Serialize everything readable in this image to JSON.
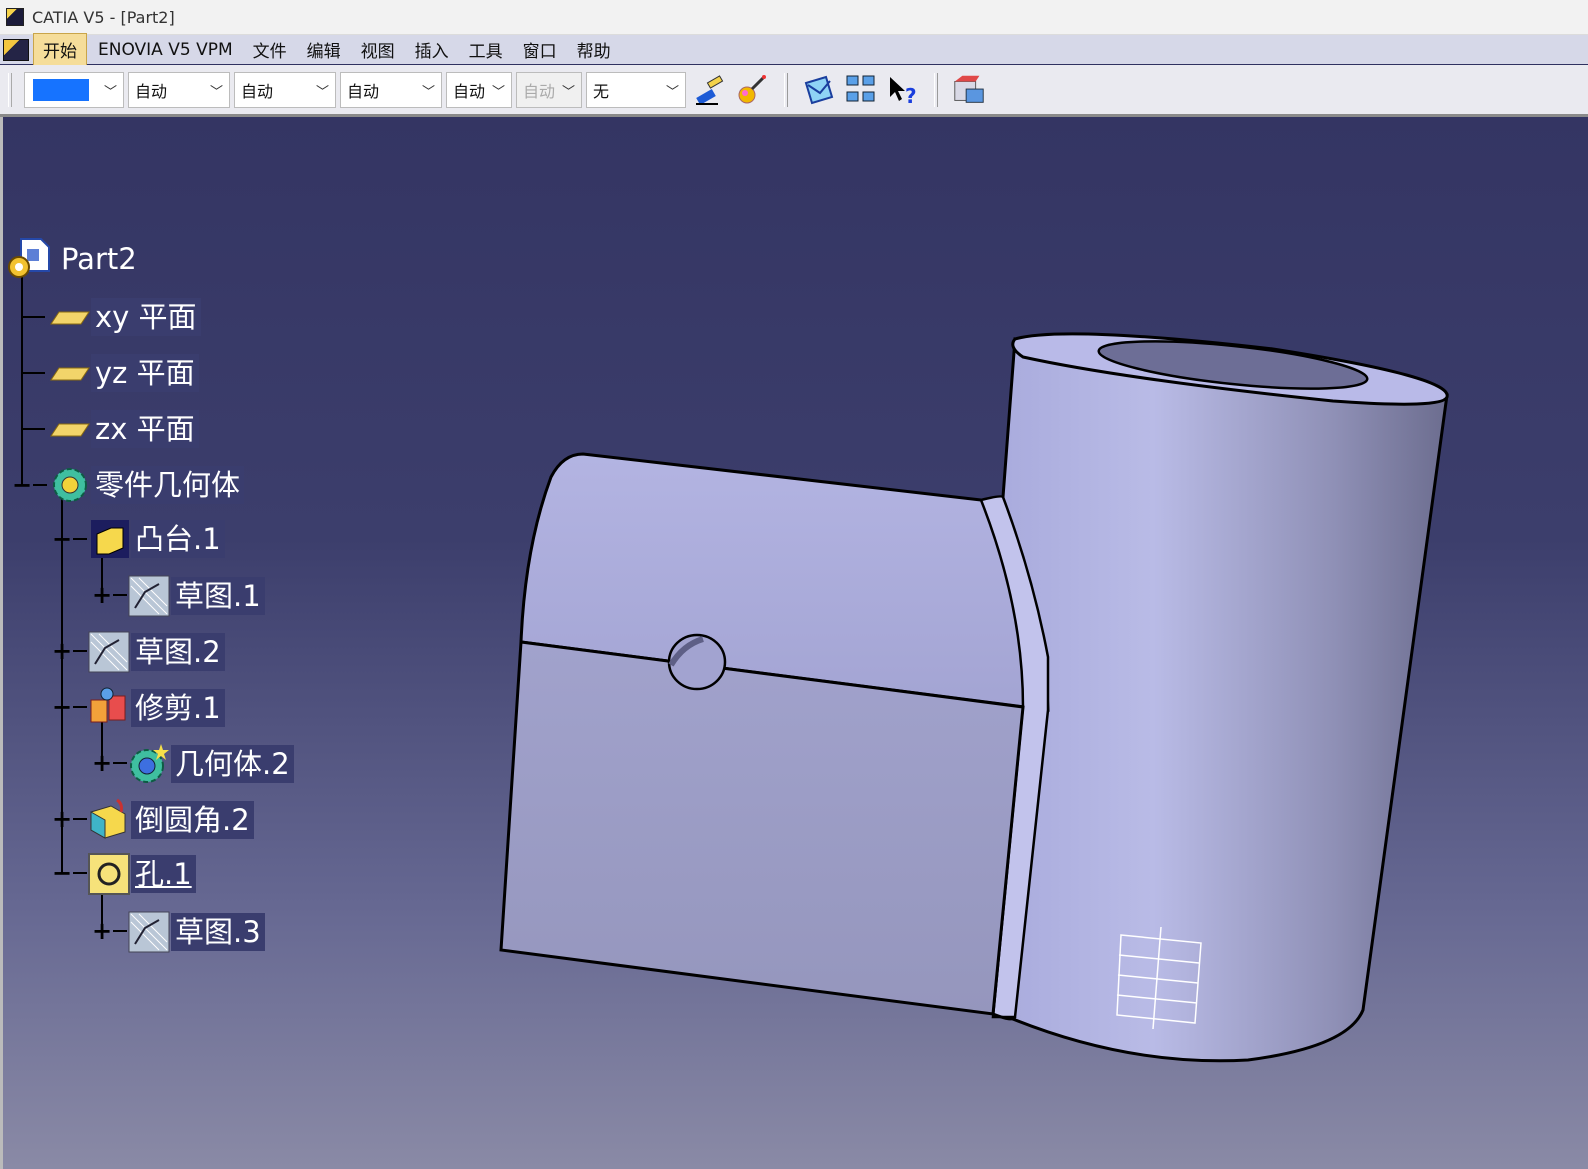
{
  "window": {
    "title": "CATIA V5 - [Part2]"
  },
  "menu": {
    "items": [
      {
        "label": "开始",
        "active": true
      },
      {
        "label": "ENOVIA V5 VPM"
      },
      {
        "label": "文件"
      },
      {
        "label": "编辑"
      },
      {
        "label": "视图"
      },
      {
        "label": "插入"
      },
      {
        "label": "工具"
      },
      {
        "label": "窗口"
      },
      {
        "label": "帮助"
      }
    ]
  },
  "toolbar": {
    "color_value": "#1673ff",
    "combos": [
      "自动",
      "自动",
      "自动",
      "自动",
      "自动",
      "无"
    ],
    "icons": [
      "paint-brush-icon",
      "magic-wand-icon",
      "graphic-properties-icon",
      "multi-view-icon",
      "whats-this-help-icon",
      "catalog-icon"
    ]
  },
  "tree": {
    "root": "Part2",
    "items": [
      {
        "label": "xy 平面",
        "icon": "plane-icon"
      },
      {
        "label": "yz 平面",
        "icon": "plane-icon"
      },
      {
        "label": "zx 平面",
        "icon": "plane-icon"
      },
      {
        "label": "零件几何体",
        "icon": "body-icon"
      },
      {
        "label": "凸台.1",
        "icon": "pad-icon"
      },
      {
        "label": "草图.1",
        "icon": "sketch-icon"
      },
      {
        "label": "草图.2",
        "icon": "sketch-icon"
      },
      {
        "label": "修剪.1",
        "icon": "trim-icon"
      },
      {
        "label": "几何体.2",
        "icon": "body-icon"
      },
      {
        "label": "倒圆角.2",
        "icon": "fillet-icon"
      },
      {
        "label": "孔.1",
        "icon": "hole-icon"
      },
      {
        "label": "草图.3",
        "icon": "sketch-icon"
      }
    ]
  },
  "colors": {
    "viewport_bg": "#343563",
    "part_surface": "#b4b5dd",
    "menu_active": "#f5dd9a"
  }
}
